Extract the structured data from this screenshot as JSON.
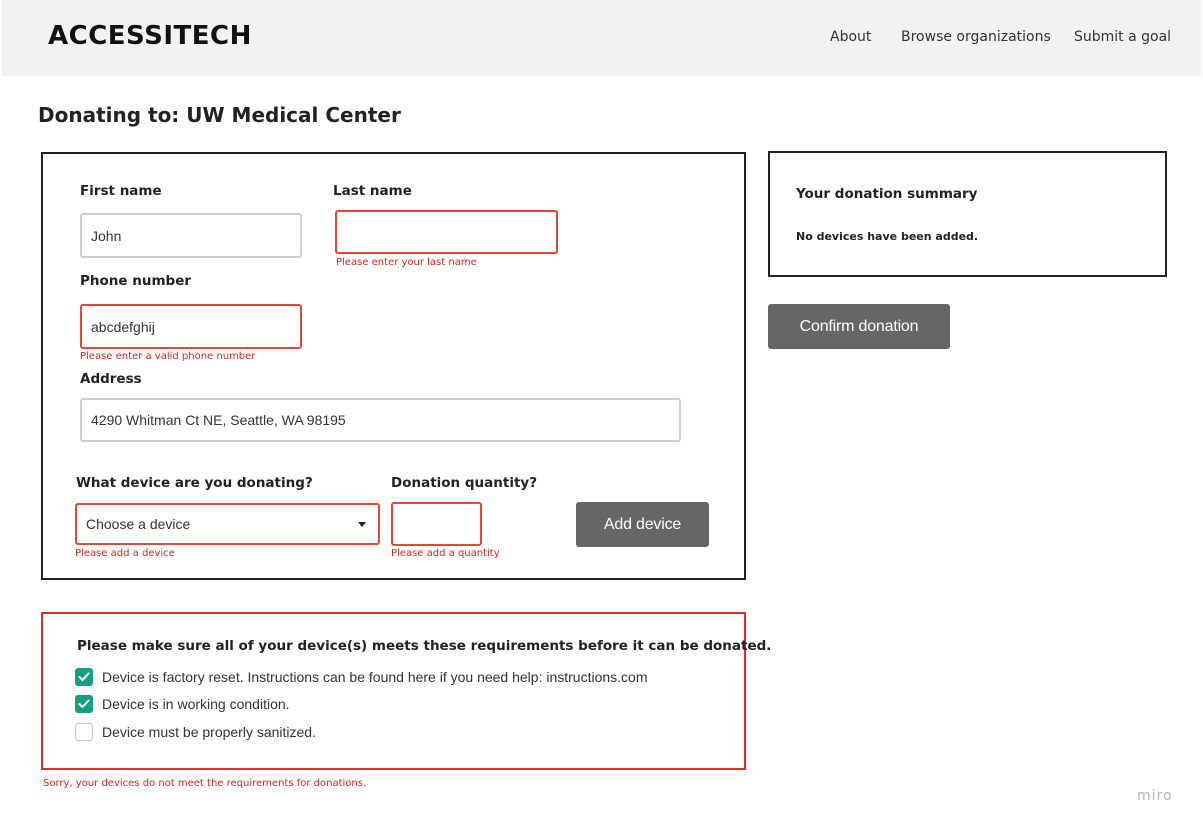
{
  "header": {
    "logo": "ACCESSITECH",
    "nav": {
      "about": "About",
      "browse": "Browse organizations",
      "submit": "Submit a goal"
    }
  },
  "page": {
    "title": "Donating to: UW Medical Center"
  },
  "form": {
    "first_name": {
      "label": "First name",
      "value": "John"
    },
    "last_name": {
      "label": "Last name",
      "value": "",
      "error": "Please enter your last name"
    },
    "phone": {
      "label": "Phone number",
      "value": "abcdefghij",
      "error": "Please enter a valid phone number"
    },
    "address": {
      "label": "Address",
      "value": "4290 Whitman Ct NE, Seattle, WA 98195"
    },
    "device": {
      "label": "What device are you donating?",
      "selected": "Choose a device",
      "error": "Please add a device"
    },
    "quantity": {
      "label": "Donation quantity?",
      "value": "",
      "error": "Please add a quantity"
    },
    "add_device_label": "Add device"
  },
  "summary": {
    "title": "Your donation summary",
    "empty_text": "No devices have been added.",
    "confirm_label": "Confirm donation"
  },
  "requirements": {
    "title": "Please make sure all of your device(s) meets these requirements before it can be donated.",
    "items": [
      {
        "label": "Device is factory reset. Instructions can be found here if you need help: instructions.com",
        "checked": true
      },
      {
        "label": "Device is in working condition.",
        "checked": true
      },
      {
        "label": "Device must be properly sanitized.",
        "checked": false
      }
    ],
    "error": "Sorry, your devices do not meet the requirements for donations."
  },
  "watermark": "miro",
  "colors": {
    "accent_check": "#14a085",
    "error": "#d0281e",
    "button": "#666666"
  }
}
